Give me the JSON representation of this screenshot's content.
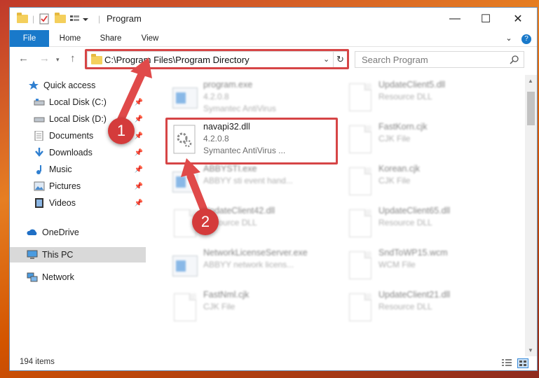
{
  "window": {
    "title": "Program",
    "controls": {
      "minimize": "—",
      "maximize": "☐",
      "close": "✕"
    }
  },
  "ribbon": {
    "tabs": [
      {
        "label": "File"
      },
      {
        "label": "Home"
      },
      {
        "label": "Share"
      },
      {
        "label": "View"
      }
    ],
    "help": "?"
  },
  "address": {
    "path": "C:\\Program Files\\Program Directory",
    "search_placeholder": "Search Program"
  },
  "sidebar": {
    "items": [
      {
        "label": "Quick access",
        "icon": "star-icon"
      },
      {
        "label": "Local Disk (C:)",
        "icon": "drive-icon",
        "pinned": true
      },
      {
        "label": "Local Disk (D:)",
        "icon": "drive-icon",
        "pinned": true
      },
      {
        "label": "Documents",
        "icon": "documents-icon",
        "pinned": true
      },
      {
        "label": "Downloads",
        "icon": "download-icon",
        "pinned": true
      },
      {
        "label": "Music",
        "icon": "music-icon",
        "pinned": true
      },
      {
        "label": "Pictures",
        "icon": "pictures-icon",
        "pinned": true
      },
      {
        "label": "Videos",
        "icon": "videos-icon",
        "pinned": true
      },
      {
        "label": "OneDrive",
        "icon": "cloud-icon"
      },
      {
        "label": "This PC",
        "icon": "computer-icon",
        "selected": true
      },
      {
        "label": "Network",
        "icon": "network-icon"
      }
    ]
  },
  "files": [
    {
      "name": "program.exe",
      "version": "4.2.0.8",
      "description": "Symantec AntiVirus",
      "type": "app"
    },
    {
      "name": "UpdateClient5.dll",
      "version": "",
      "description": "Resource DLL",
      "type": "doc"
    },
    {
      "name": "navapi32.dll",
      "version": "4.2.0.8",
      "description": "Symantec AntiVirus ...",
      "type": "dll",
      "highlighted": true
    },
    {
      "name": "FastKorn.cjk",
      "version": "",
      "description": "CJK File",
      "type": "doc"
    },
    {
      "name": "ABBYSTI.exe",
      "version": "",
      "description": "ABBYY sti event hand...",
      "type": "app"
    },
    {
      "name": "Korean.cjk",
      "version": "",
      "description": "CJK File",
      "type": "doc"
    },
    {
      "name": "UpdateClient42.dll",
      "version": "",
      "description": "Resource DLL",
      "type": "doc"
    },
    {
      "name": "UpdateClient65.dll",
      "version": "",
      "description": "Resource DLL",
      "type": "doc"
    },
    {
      "name": "NetworkLicenseServer.exe",
      "version": "",
      "description": "ABBYY network licens...",
      "type": "app"
    },
    {
      "name": "SndToWP15.wcm",
      "version": "",
      "description": "WCM File",
      "type": "doc"
    },
    {
      "name": "FastNml.cjk",
      "version": "",
      "description": "CJK File",
      "type": "doc"
    },
    {
      "name": "UpdateClient21.dll",
      "version": "",
      "description": "Resource DLL",
      "type": "doc"
    }
  ],
  "status": {
    "count": "194 items"
  },
  "annotations": {
    "step1": "1",
    "step2": "2",
    "color": "#d64546"
  }
}
